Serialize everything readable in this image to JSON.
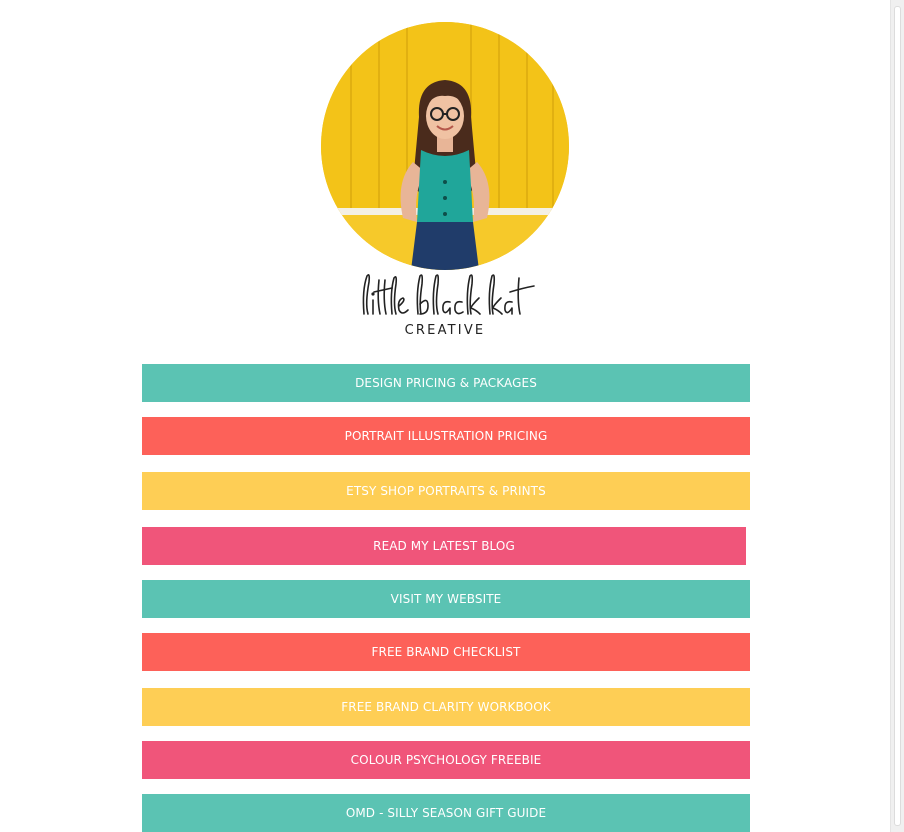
{
  "profile": {
    "logo_script": "little black kat",
    "logo_sub": "CREATIVE"
  },
  "colors": {
    "teal": "#5bc3b3",
    "coral": "#fd6159",
    "yellow": "#fece55",
    "pink": "#f0557a"
  },
  "links": [
    {
      "label": "DESIGN PRICING & PACKAGES",
      "color": "#5bc3b3"
    },
    {
      "label": "PORTRAIT ILLUSTRATION PRICING",
      "color": "#fd6159"
    },
    {
      "label": "ETSY SHOP PORTRAITS & PRINTS",
      "color": "#fece55"
    },
    {
      "label": "READ MY LATEST BLOG",
      "color": "#f0557a"
    },
    {
      "label": "VISIT MY WEBSITE",
      "color": "#5bc3b3"
    },
    {
      "label": "FREE BRAND CHECKLIST",
      "color": "#fd6159"
    },
    {
      "label": "FREE BRAND CLARITY WORKBOOK",
      "color": "#fece55"
    },
    {
      "label": "COLOUR PSYCHOLOGY FREEBIE",
      "color": "#f0557a"
    },
    {
      "label": "OMD - SILLY SEASON GIFT GUIDE",
      "color": "#5bc3b3"
    }
  ]
}
